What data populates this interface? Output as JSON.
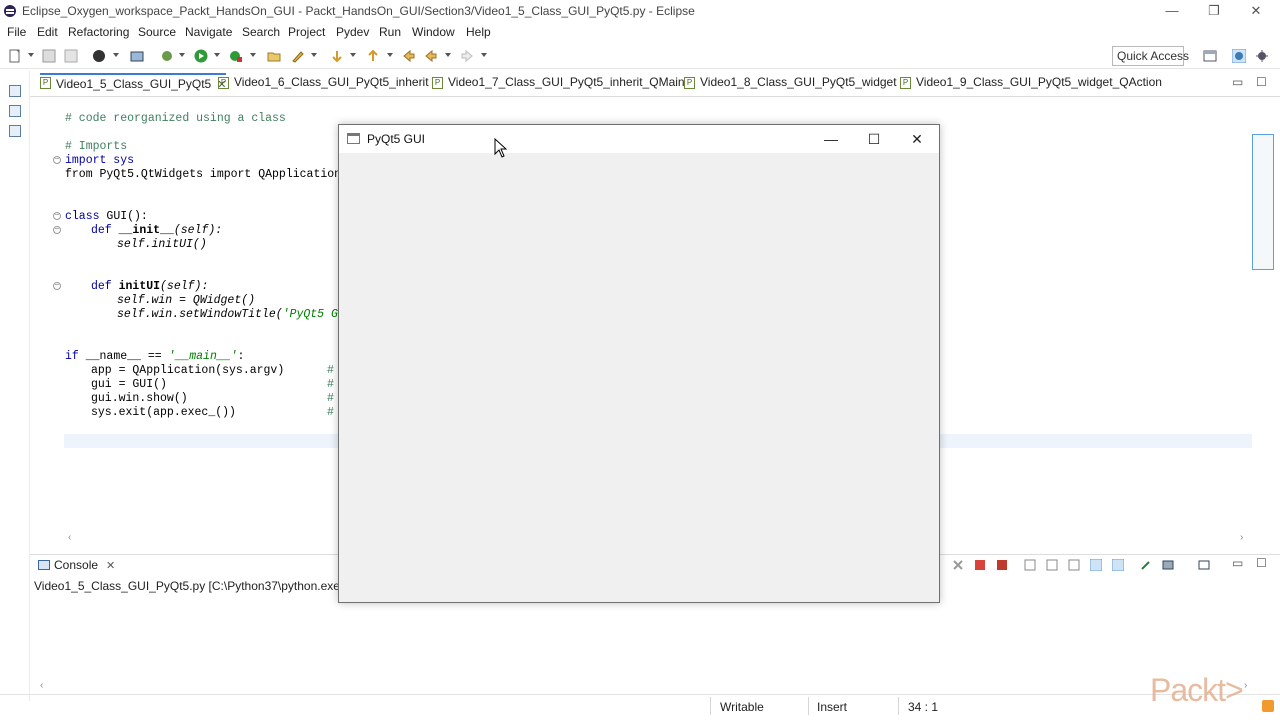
{
  "window": {
    "title": "Eclipse_Oxygen_workspace_Packt_HandsOn_GUI - Packt_HandsOn_GUI/Section3/Video1_5_Class_GUI_PyQt5.py - Eclipse",
    "min": "—",
    "restore": "❐",
    "close": "✕"
  },
  "menu": [
    "File",
    "Edit",
    "Refactoring",
    "Source",
    "Navigate",
    "Search",
    "Project",
    "Pydev",
    "Run",
    "Window",
    "Help"
  ],
  "toolbar": {
    "quick_access": "Quick Access"
  },
  "tabs": [
    {
      "label": "Video1_5_Class_GUI_PyQt5",
      "active": true
    },
    {
      "label": "Video1_6_Class_GUI_PyQt5_inherit"
    },
    {
      "label": "Video1_7_Class_GUI_PyQt5_inherit_QMain"
    },
    {
      "label": "Video1_8_Class_GUI_PyQt5_widget"
    },
    {
      "label": "Video1_9_Class_GUI_PyQt5_widget_QAction"
    }
  ],
  "code": {
    "l1": "# code reorganized using a class",
    "l3": "# Imports",
    "l4": "import sys",
    "l5": "from PyQt5.QtWidgets import QApplication,",
    "l8_kw": "class",
    "l8_rest": " GUI():",
    "l9_kw": "def",
    "l9_name": " __init__",
    "l9_rest": "(self):",
    "l10": "self.initUI()",
    "l13_kw": "def",
    "l13_name": " initUI",
    "l13_rest": "(self):",
    "l14": "self.win = QWidget()",
    "l15_a": "self.win.setWindowTitle(",
    "l15_b": "'PyQt5 GUI",
    "l17_kw": "if",
    "l17_a": " __name__ == ",
    "l17_b": "'__main__'",
    "l17_c": ":",
    "l18": "app = QApplication(sys.argv)",
    "l19": "gui = GUI()",
    "l20": "gui.win.show()",
    "l21": "sys.exit(app.exec_())",
    "hash": "#"
  },
  "console": {
    "tab": "Console",
    "path": "Video1_5_Class_GUI_PyQt5.py [C:\\Python37\\python.exe]"
  },
  "status": {
    "mode": "Writable",
    "insert": "Insert",
    "position": "34 : 1"
  },
  "pyqt_window": {
    "title": "PyQt5 GUI",
    "min": "—",
    "max": "☐",
    "close": "✕"
  },
  "watermark": "Packt>"
}
